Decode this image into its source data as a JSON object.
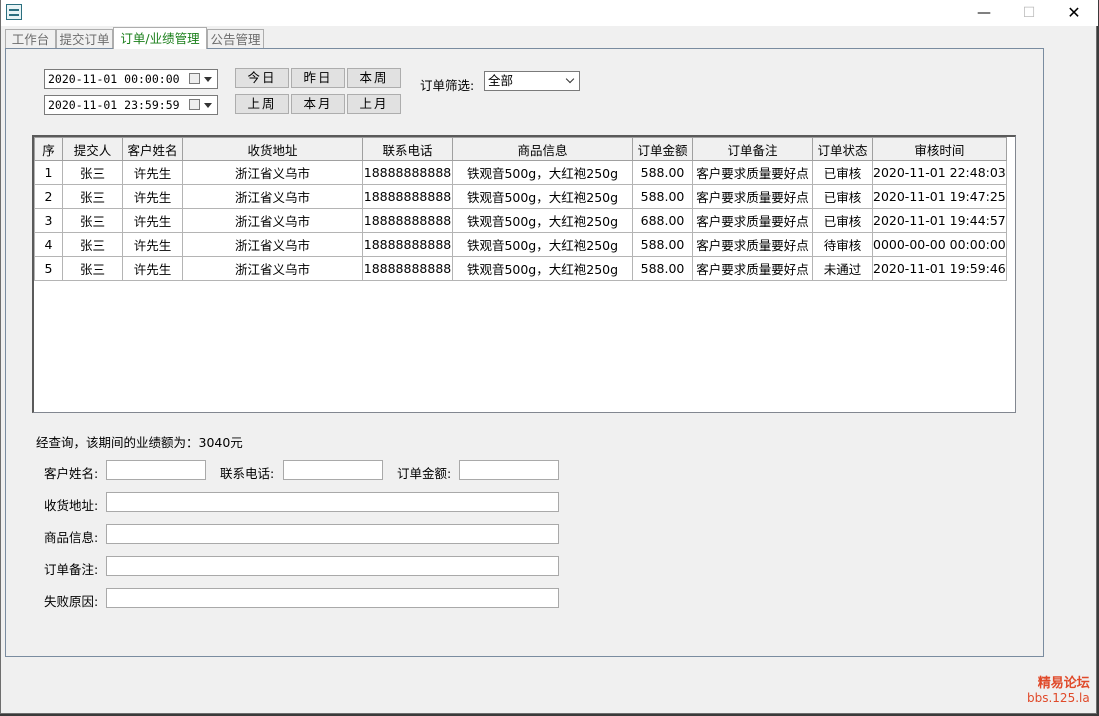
{
  "window": {
    "buttons": {
      "minimize": "—",
      "maximize": "☐",
      "close": "✕"
    }
  },
  "tabs": [
    {
      "label": "工作台"
    },
    {
      "label": "提交订单"
    },
    {
      "label": "订单/业绩管理"
    },
    {
      "label": "公告管理"
    }
  ],
  "filters": {
    "start_datetime": "2020-11-01 00:00:00",
    "end_datetime": "2020-11-01 23:59:59",
    "quick_buttons": [
      "今日",
      "昨日",
      "本周",
      "上周",
      "本月",
      "上月"
    ],
    "order_filter_label": "订单筛选:",
    "order_filter_value": "全部"
  },
  "orders_table": {
    "columns": [
      "序",
      "提交人",
      "客户姓名",
      "收货地址",
      "联系电话",
      "商品信息",
      "订单金额",
      "订单备注",
      "订单状态",
      "审核时间"
    ],
    "rows": [
      [
        "1",
        "张三",
        "许先生",
        "浙江省义乌市",
        "18888888888",
        "铁观音500g，大红袍250g",
        "588.00",
        "客户要求质量要好点",
        "已审核",
        "2020-11-01 22:48:03"
      ],
      [
        "2",
        "张三",
        "许先生",
        "浙江省义乌市",
        "18888888888",
        "铁观音500g，大红袍250g",
        "588.00",
        "客户要求质量要好点",
        "已审核",
        "2020-11-01 19:47:25"
      ],
      [
        "3",
        "张三",
        "许先生",
        "浙江省义乌市",
        "18888888888",
        "铁观音500g，大红袍250g",
        "688.00",
        "客户要求质量要好点",
        "已审核",
        "2020-11-01 19:44:57"
      ],
      [
        "4",
        "张三",
        "许先生",
        "浙江省义乌市",
        "18888888888",
        "铁观音500g，大红袍250g",
        "588.00",
        "客户要求质量要好点",
        "待审核",
        "0000-00-00 00:00:00"
      ],
      [
        "5",
        "张三",
        "许先生",
        "浙江省义乌市",
        "18888888888",
        "铁观音500g，大红袍250g",
        "588.00",
        "客户要求质量要好点",
        "未通过",
        "2020-11-01 19:59:46"
      ]
    ]
  },
  "summary_text": "经查询，该期间的业绩额为：3040元",
  "detail_form": {
    "customer_name_label": "客户姓名:",
    "phone_label": "联系电话:",
    "amount_label": "订单金额:",
    "address_label": "收货地址:",
    "product_label": "商品信息:",
    "remark_label": "订单备注:",
    "fail_reason_label": "失败原因:"
  },
  "watermark": {
    "line1": "精易论坛",
    "line2": "bbs.125.la"
  }
}
